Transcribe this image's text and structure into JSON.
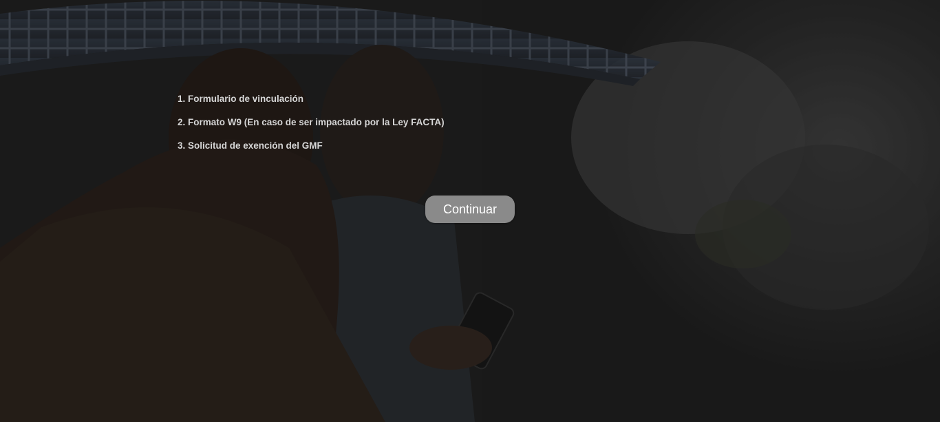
{
  "documents": [
    {
      "label": "1. Formulario de vinculación"
    },
    {
      "label": "2. Formato W9 (En caso de ser impactado por la Ley FACTA)"
    },
    {
      "label": "3. Solicitud de exención del GMF"
    }
  ],
  "actions": {
    "continue_label": "Continuar"
  },
  "colors": {
    "overlay": "#1c1c1c",
    "button_bg": "#8a8a8a",
    "button_text": "#ffffff",
    "list_text": "#d6d6d6"
  },
  "icons": {
    "background": "people-under-umbrella-photo"
  }
}
